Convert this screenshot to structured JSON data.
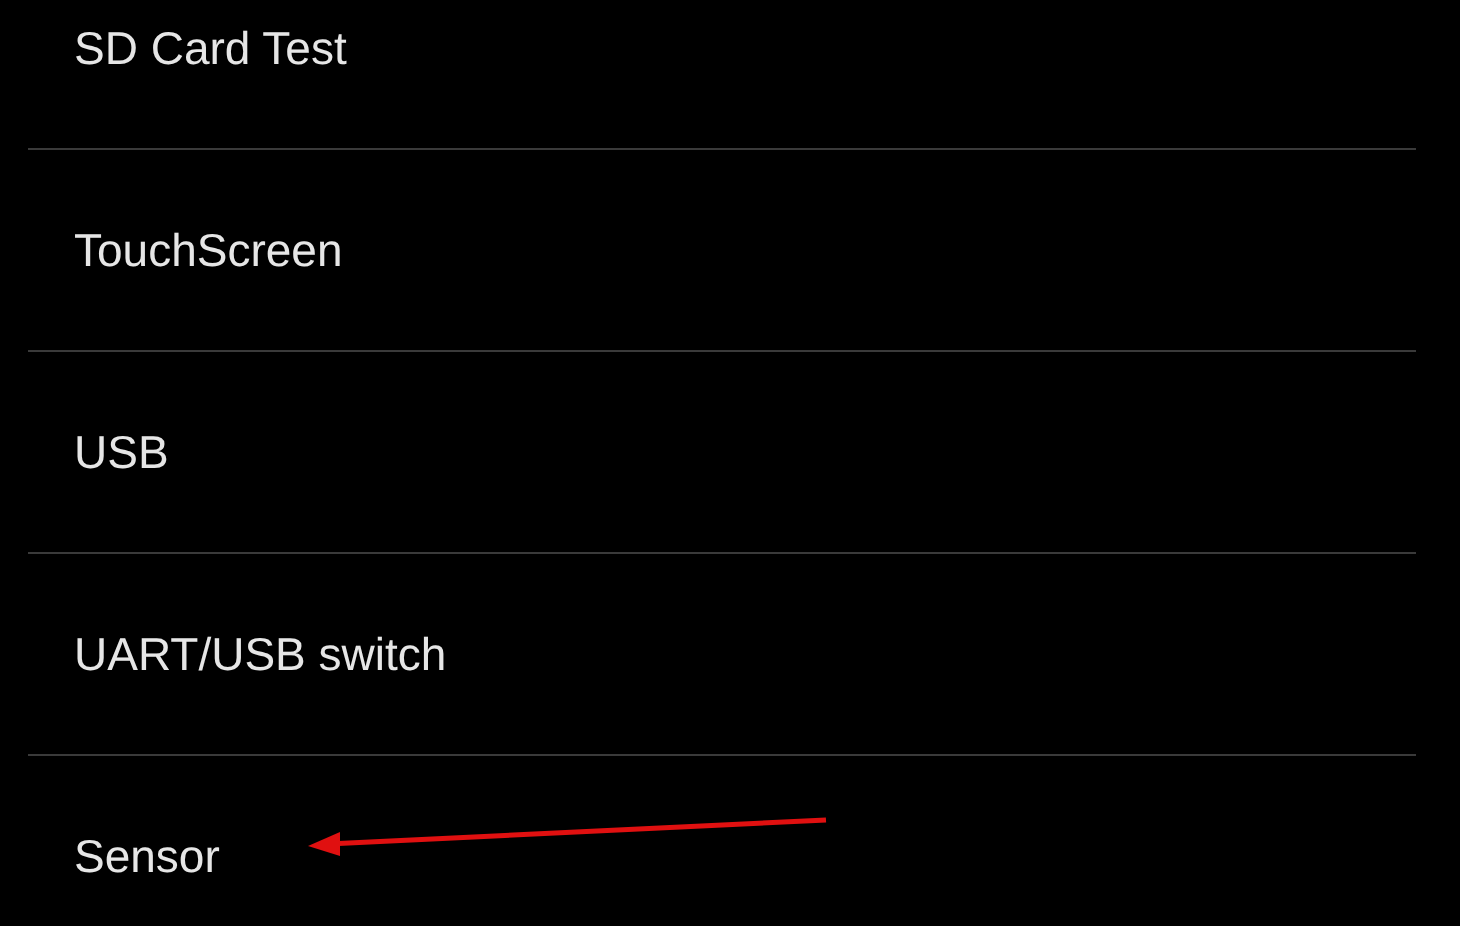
{
  "menu": {
    "items": [
      {
        "label": "SD Card Test"
      },
      {
        "label": "TouchScreen"
      },
      {
        "label": "USB"
      },
      {
        "label": "UART/USB switch"
      },
      {
        "label": "Sensor"
      }
    ]
  }
}
